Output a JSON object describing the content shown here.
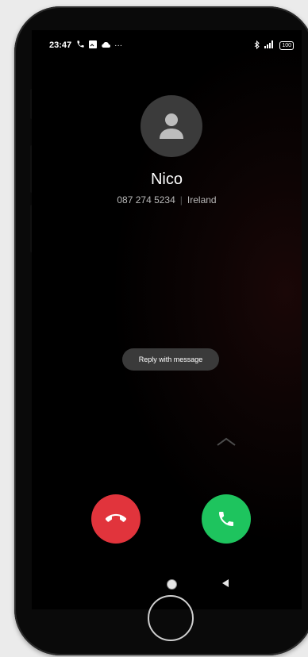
{
  "status_bar": {
    "time": "23:47",
    "left_icons": [
      "phone-icon",
      "image-icon",
      "cloud-icon",
      "more-icon"
    ],
    "more": "···",
    "right_icons": [
      "bluetooth-icon",
      "signal-icon",
      "battery-icon"
    ],
    "battery": "100"
  },
  "contact": {
    "name": "Nico",
    "number": "087 274 5234",
    "location": "Ireland"
  },
  "actions": {
    "reply_label": "Reply with message",
    "decline_color": "#e1343c",
    "accept_color": "#1ec45e"
  }
}
